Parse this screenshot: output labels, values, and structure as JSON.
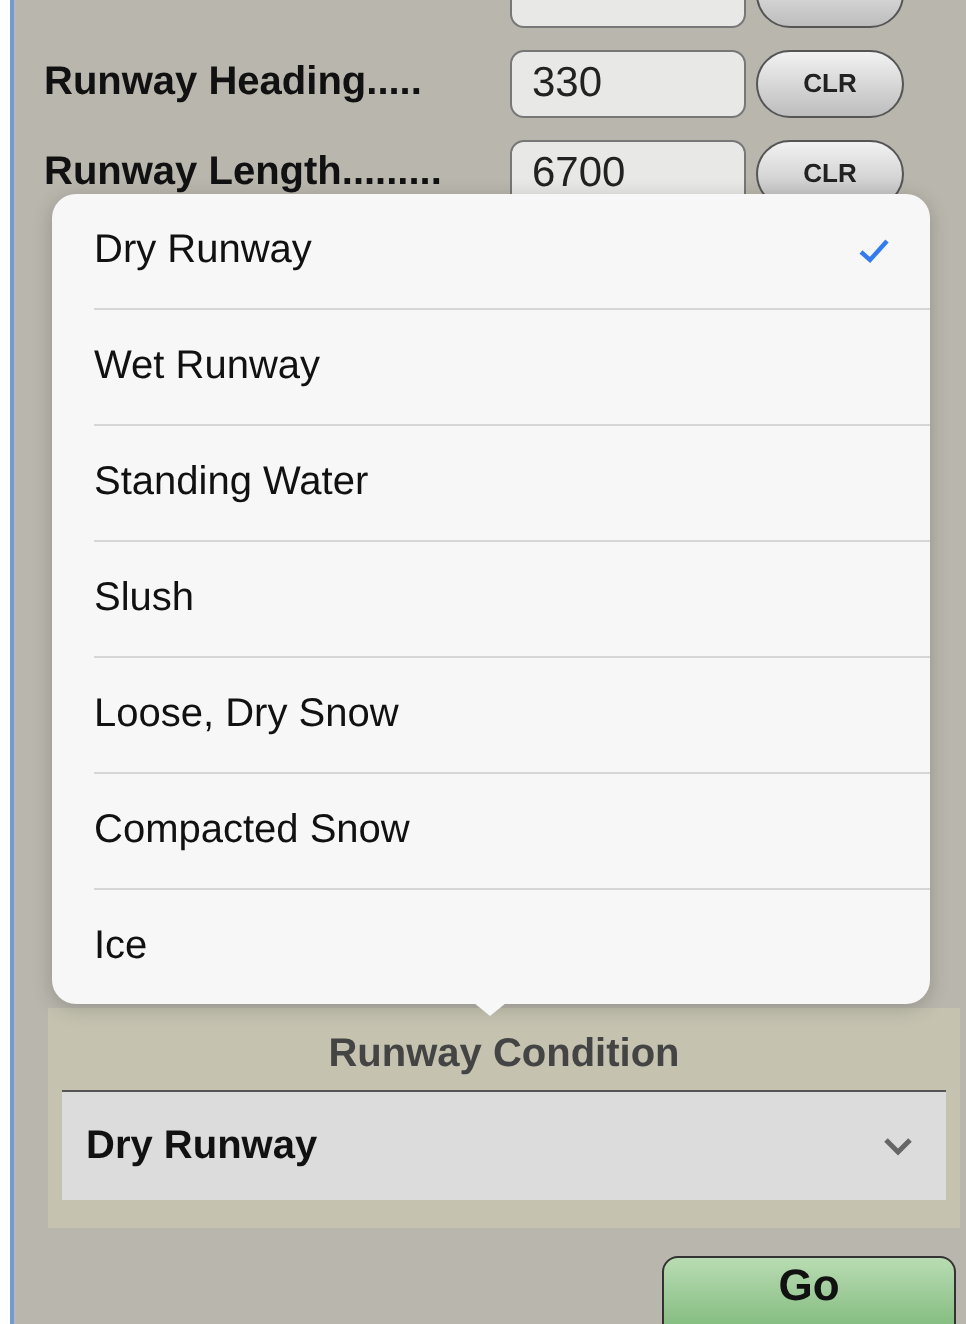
{
  "form_rows": [
    {},
    {
      "label": "Runway Heading.....",
      "value": "330",
      "button": "CLR"
    },
    {
      "label": "Runway Length.........",
      "value": "6700",
      "button": "CLR"
    }
  ],
  "condition_picker": {
    "label": "Runway Condition",
    "value": "Dry Runway"
  },
  "popover": {
    "options": [
      {
        "label": "Dry Runway",
        "selected": true
      },
      {
        "label": "Wet Runway",
        "selected": false
      },
      {
        "label": "Standing Water",
        "selected": false
      },
      {
        "label": "Slush",
        "selected": false
      },
      {
        "label": "Loose, Dry Snow",
        "selected": false
      },
      {
        "label": "Compacted Snow",
        "selected": false
      },
      {
        "label": "Ice",
        "selected": false
      }
    ]
  },
  "go_button": "Go"
}
